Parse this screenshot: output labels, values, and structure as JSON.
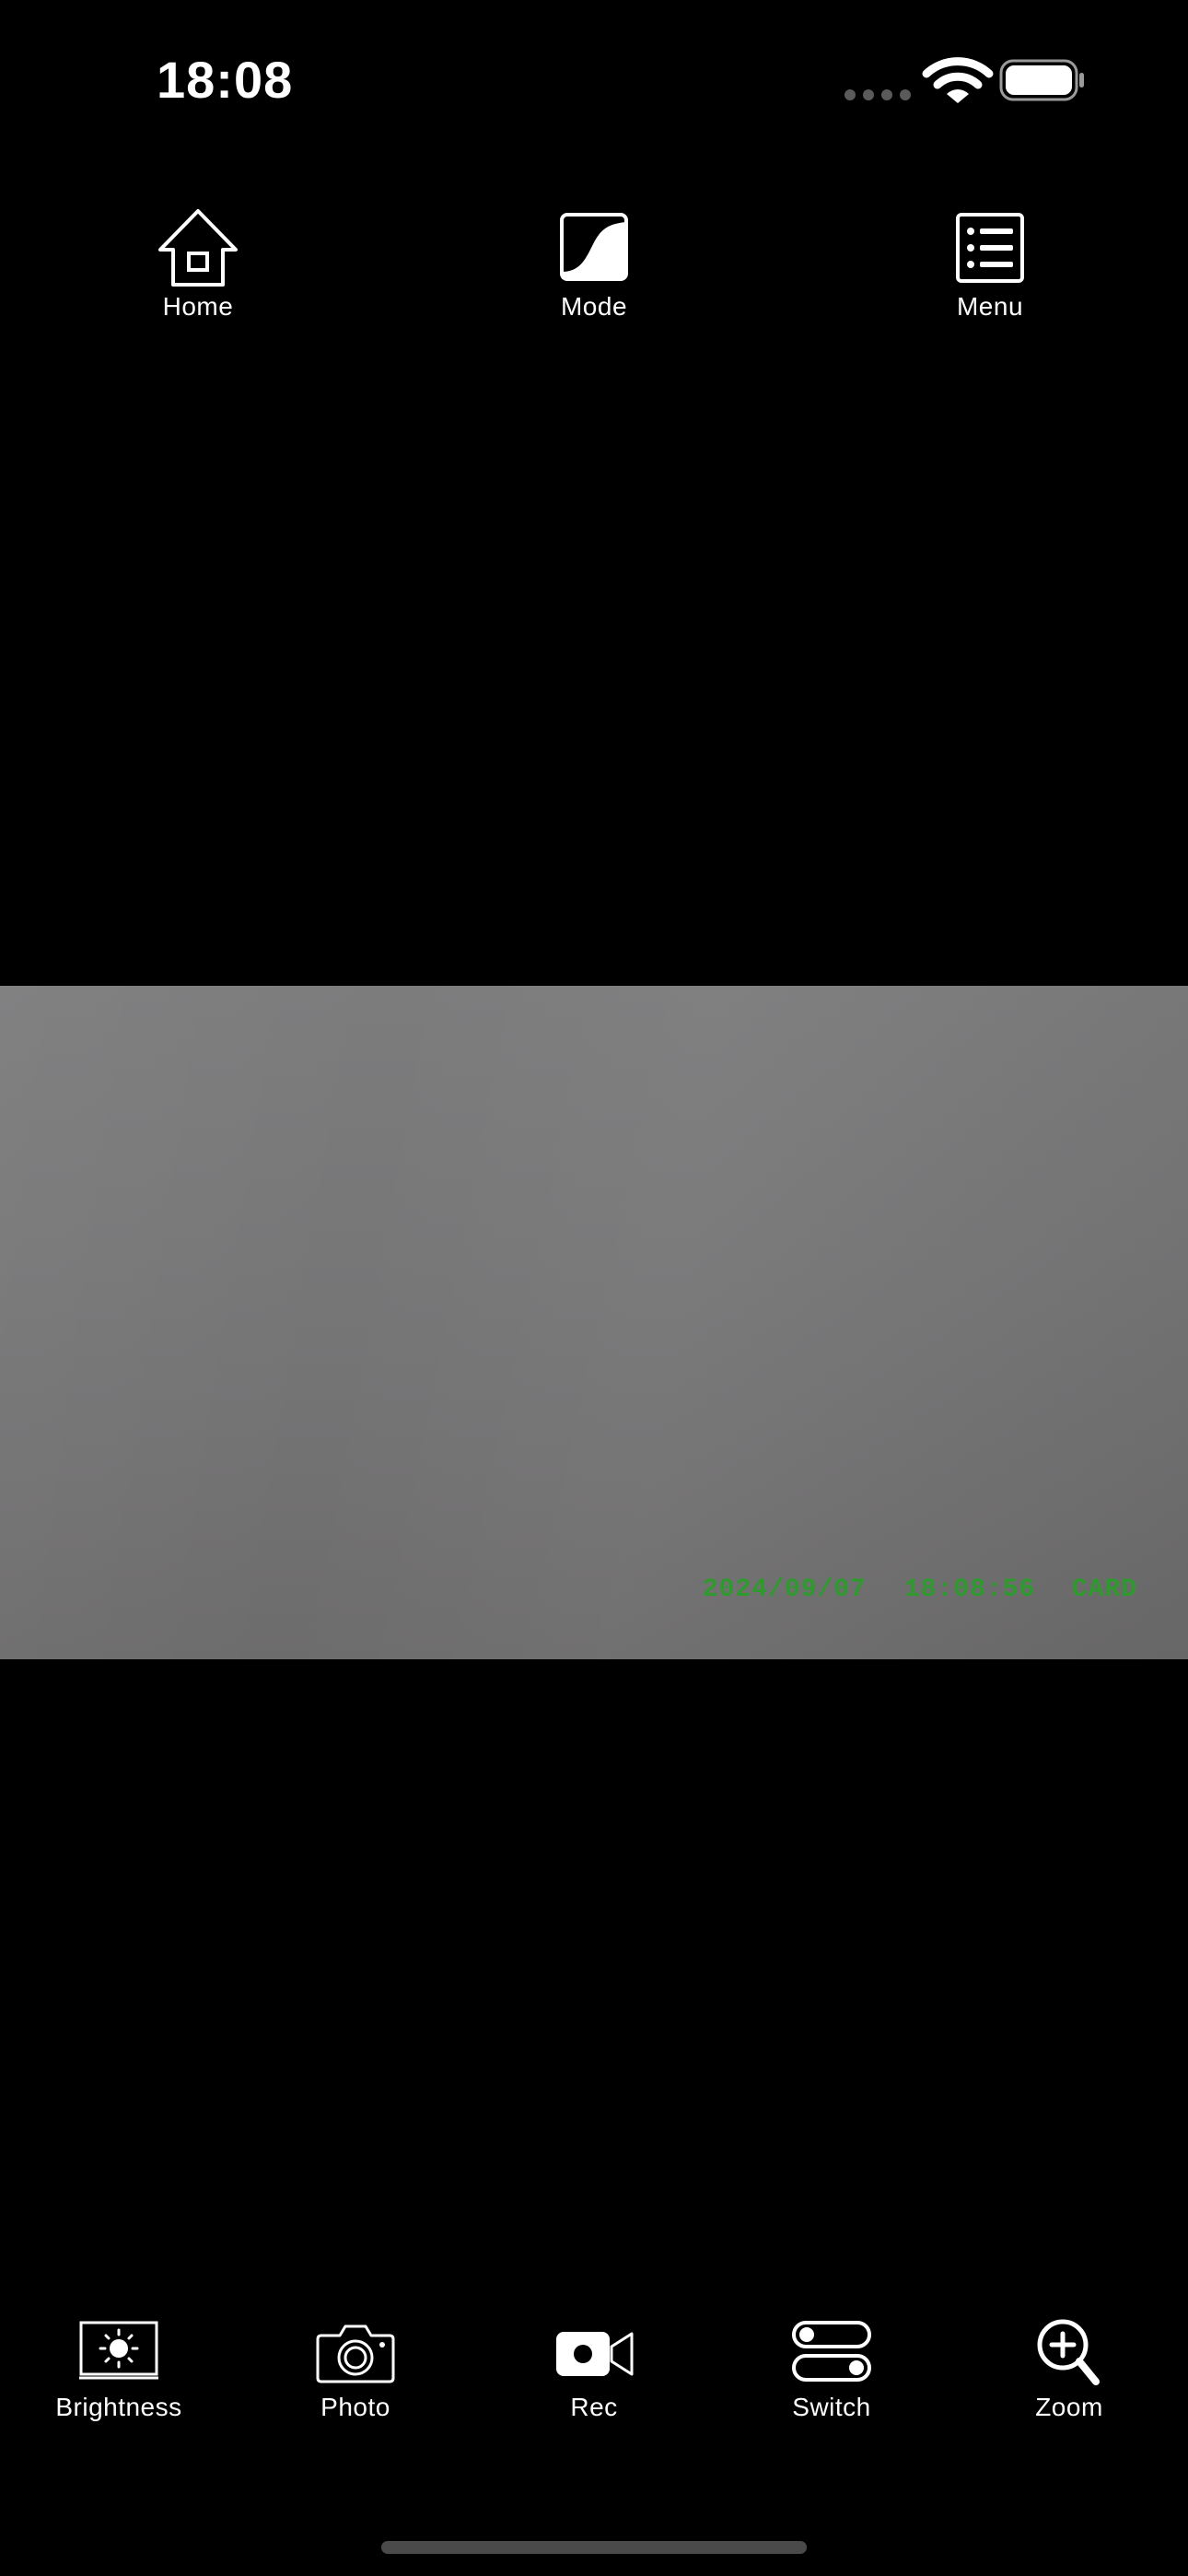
{
  "status_bar": {
    "time": "18:08"
  },
  "top_nav": {
    "home_label": "Home",
    "mode_label": "Mode",
    "menu_label": "Menu"
  },
  "camera_feed": {
    "osd_date": "2024/09/07",
    "osd_time": "18:08:56",
    "osd_tag": "CARD"
  },
  "toolbar": {
    "brightness_label": "Brightness",
    "photo_label": "Photo",
    "rec_label": "Rec",
    "switch_label": "Switch",
    "zoom_label": "Zoom"
  },
  "colors": {
    "background": "#000000",
    "icon": "#ffffff",
    "osd_text": "#2e9a2e",
    "feed_gray": "#777778"
  },
  "icons": {
    "home": "home-icon",
    "mode": "mode-icon",
    "menu": "menu-icon",
    "brightness": "brightness-icon",
    "photo": "camera-icon",
    "rec": "video-camera-icon",
    "switch": "toggle-switch-icon",
    "zoom": "zoom-in-icon"
  }
}
